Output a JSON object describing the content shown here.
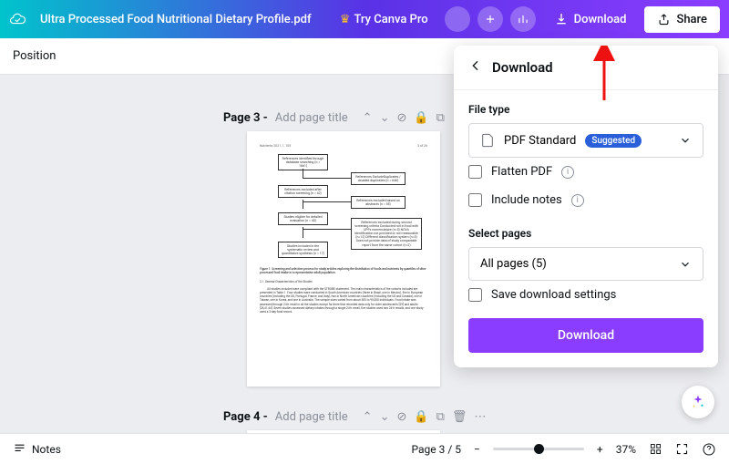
{
  "topbar": {
    "filename": "Ultra Processed Food Nutritional Dietary Profile.pdf",
    "try_pro": "Try Canva Pro",
    "download": "Download",
    "share": "Share"
  },
  "toolbar": {
    "position": "Position"
  },
  "pages": {
    "page3_label": "Page 3 -",
    "page3_hint": "Add page title",
    "page4_label": "Page 4 -",
    "page4_hint": "Add page title"
  },
  "popover": {
    "title": "Download",
    "file_type_label": "File type",
    "file_type_value": "PDF Standard",
    "badge": "Suggested",
    "flatten": "Flatten PDF",
    "include_notes": "Include notes",
    "select_pages_label": "Select pages",
    "pages_value": "All pages (5)",
    "save_settings": "Save download settings",
    "download_btn": "Download"
  },
  "bottombar": {
    "notes": "Notes",
    "page_indicator": "Page 3 / 5",
    "zoom": "37%"
  },
  "thumb": {
    "journal": "Nutrients 2021, 1, 105",
    "pagenum": "3 of 26",
    "box1": "References identified through database searching\n(n = 1661)",
    "box2": "References excluded after citation screening\n(n = 42)",
    "box3": "References ExcludeDuplicates / doubled duplicates\n(n = 646)",
    "box4": "References excluded based on abstracts\n(n = 55)",
    "box5": "Studies eligible for detailed evaluation\n(n = 40)",
    "box6": "References excluded during second screening criteria\nConducted not in food with UPFs nomenclature (n=5)\nNOVA identification not provided or not measurable (n=12)\nDifferent classification system (n=5)\nDoes not provide data of study comparable report from the same cohort (n=2)",
    "box7": "Studies included in the systematic review and quantitative synthesis (n = 17)",
    "caption": "Figure 1. Screening and selection process for study articles exploring the distribution of foods and nutrients by quantiles of ultra-processed food intake in a representative adult population.",
    "heading": "3.1. General Characteristics of the Studies",
    "body": "All studies included were compliant with the STROBE statement. The main characteristics of the cohorts included are presented in Table 1. Four studies were conducted in South American countries (three in Brazil, one in Mexico), five in European countries (including the UK, Portugal, France, and Italy), two in North American countries (including the US and Canada), one in Taiwan, one in Korea, and one in Australia. The sample sizes varied from about 500 to 90,000 individuals. Food intake was assessed through 24-h recall in all the studies except for three that recorded data only for older adolescents [29] and adults [28,41,44]. Seven studies assessed dietary intakes through a single 24-h recall, five studies used two 24-h recalls, and one study used a 3-day food record."
  }
}
